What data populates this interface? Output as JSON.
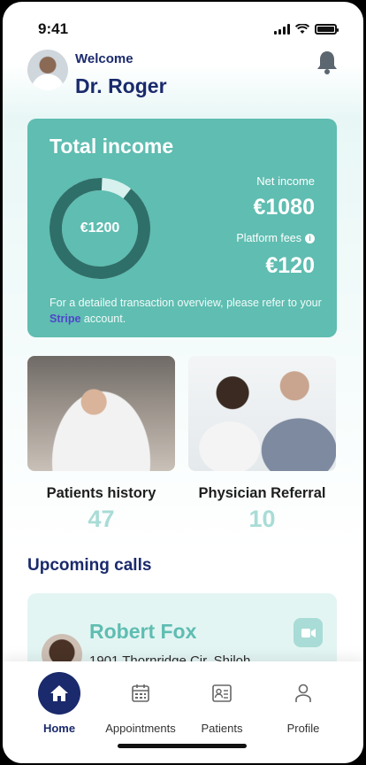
{
  "status_bar": {
    "time": "9:41"
  },
  "header": {
    "greeting": "Welcome",
    "name": "Dr. Roger"
  },
  "income_card": {
    "title": "Total income",
    "total": "€1200",
    "net_label": "Net income",
    "net_value": "€1080",
    "fees_label": "Platform fees",
    "fees_value": "€120",
    "net_fraction": 0.9,
    "note_before": "For a detailed transaction overview, please refer to your ",
    "note_link": "Stripe",
    "note_after": " account."
  },
  "tiles": [
    {
      "label": "Patients history",
      "count": "47"
    },
    {
      "label": "Physician Referral",
      "count": "10"
    }
  ],
  "upcoming": {
    "title": "Upcoming calls",
    "calls": [
      {
        "name": "Robert Fox",
        "address": "1901 Thornridge Cir. Shiloh"
      }
    ]
  },
  "nav": {
    "items": [
      {
        "label": "Home",
        "icon": "home-icon",
        "active": true
      },
      {
        "label": "Appointments",
        "icon": "calendar-icon",
        "active": false
      },
      {
        "label": "Patients",
        "icon": "patient-card-icon",
        "active": false
      },
      {
        "label": "Profile",
        "icon": "person-icon",
        "active": false
      }
    ]
  },
  "colors": {
    "teal": "#5fbdb1",
    "navy": "#1a2a6c",
    "light_teal": "#a9dcd6",
    "stripe": "#4f46c8"
  }
}
